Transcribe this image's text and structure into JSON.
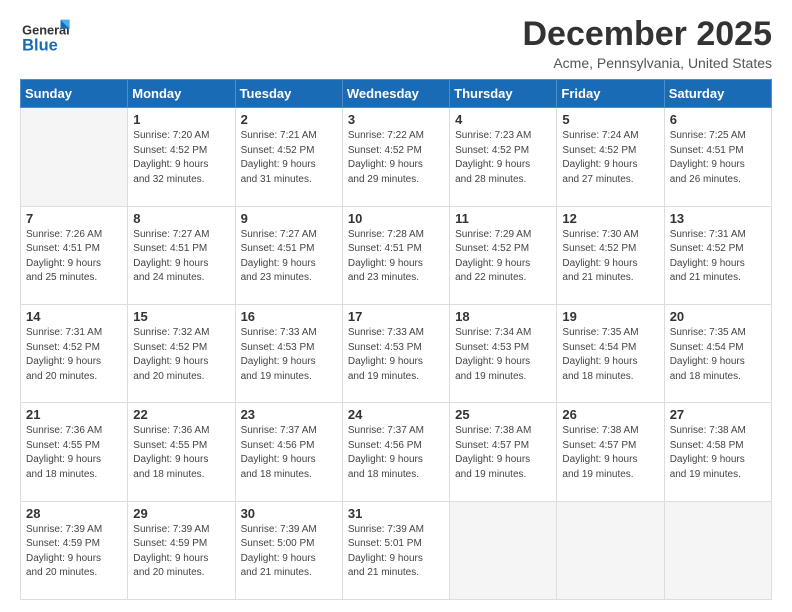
{
  "header": {
    "logo": {
      "line1": "General",
      "line2": "Blue"
    },
    "title": "December 2025",
    "location": "Acme, Pennsylvania, United States"
  },
  "weekdays": [
    "Sunday",
    "Monday",
    "Tuesday",
    "Wednesday",
    "Thursday",
    "Friday",
    "Saturday"
  ],
  "weeks": [
    [
      {
        "day": "",
        "info": ""
      },
      {
        "day": "1",
        "info": "Sunrise: 7:20 AM\nSunset: 4:52 PM\nDaylight: 9 hours\nand 32 minutes."
      },
      {
        "day": "2",
        "info": "Sunrise: 7:21 AM\nSunset: 4:52 PM\nDaylight: 9 hours\nand 31 minutes."
      },
      {
        "day": "3",
        "info": "Sunrise: 7:22 AM\nSunset: 4:52 PM\nDaylight: 9 hours\nand 29 minutes."
      },
      {
        "day": "4",
        "info": "Sunrise: 7:23 AM\nSunset: 4:52 PM\nDaylight: 9 hours\nand 28 minutes."
      },
      {
        "day": "5",
        "info": "Sunrise: 7:24 AM\nSunset: 4:52 PM\nDaylight: 9 hours\nand 27 minutes."
      },
      {
        "day": "6",
        "info": "Sunrise: 7:25 AM\nSunset: 4:51 PM\nDaylight: 9 hours\nand 26 minutes."
      }
    ],
    [
      {
        "day": "7",
        "info": "Sunrise: 7:26 AM\nSunset: 4:51 PM\nDaylight: 9 hours\nand 25 minutes."
      },
      {
        "day": "8",
        "info": "Sunrise: 7:27 AM\nSunset: 4:51 PM\nDaylight: 9 hours\nand 24 minutes."
      },
      {
        "day": "9",
        "info": "Sunrise: 7:27 AM\nSunset: 4:51 PM\nDaylight: 9 hours\nand 23 minutes."
      },
      {
        "day": "10",
        "info": "Sunrise: 7:28 AM\nSunset: 4:51 PM\nDaylight: 9 hours\nand 23 minutes."
      },
      {
        "day": "11",
        "info": "Sunrise: 7:29 AM\nSunset: 4:52 PM\nDaylight: 9 hours\nand 22 minutes."
      },
      {
        "day": "12",
        "info": "Sunrise: 7:30 AM\nSunset: 4:52 PM\nDaylight: 9 hours\nand 21 minutes."
      },
      {
        "day": "13",
        "info": "Sunrise: 7:31 AM\nSunset: 4:52 PM\nDaylight: 9 hours\nand 21 minutes."
      }
    ],
    [
      {
        "day": "14",
        "info": "Sunrise: 7:31 AM\nSunset: 4:52 PM\nDaylight: 9 hours\nand 20 minutes."
      },
      {
        "day": "15",
        "info": "Sunrise: 7:32 AM\nSunset: 4:52 PM\nDaylight: 9 hours\nand 20 minutes."
      },
      {
        "day": "16",
        "info": "Sunrise: 7:33 AM\nSunset: 4:53 PM\nDaylight: 9 hours\nand 19 minutes."
      },
      {
        "day": "17",
        "info": "Sunrise: 7:33 AM\nSunset: 4:53 PM\nDaylight: 9 hours\nand 19 minutes."
      },
      {
        "day": "18",
        "info": "Sunrise: 7:34 AM\nSunset: 4:53 PM\nDaylight: 9 hours\nand 19 minutes."
      },
      {
        "day": "19",
        "info": "Sunrise: 7:35 AM\nSunset: 4:54 PM\nDaylight: 9 hours\nand 18 minutes."
      },
      {
        "day": "20",
        "info": "Sunrise: 7:35 AM\nSunset: 4:54 PM\nDaylight: 9 hours\nand 18 minutes."
      }
    ],
    [
      {
        "day": "21",
        "info": "Sunrise: 7:36 AM\nSunset: 4:55 PM\nDaylight: 9 hours\nand 18 minutes."
      },
      {
        "day": "22",
        "info": "Sunrise: 7:36 AM\nSunset: 4:55 PM\nDaylight: 9 hours\nand 18 minutes."
      },
      {
        "day": "23",
        "info": "Sunrise: 7:37 AM\nSunset: 4:56 PM\nDaylight: 9 hours\nand 18 minutes."
      },
      {
        "day": "24",
        "info": "Sunrise: 7:37 AM\nSunset: 4:56 PM\nDaylight: 9 hours\nand 18 minutes."
      },
      {
        "day": "25",
        "info": "Sunrise: 7:38 AM\nSunset: 4:57 PM\nDaylight: 9 hours\nand 19 minutes."
      },
      {
        "day": "26",
        "info": "Sunrise: 7:38 AM\nSunset: 4:57 PM\nDaylight: 9 hours\nand 19 minutes."
      },
      {
        "day": "27",
        "info": "Sunrise: 7:38 AM\nSunset: 4:58 PM\nDaylight: 9 hours\nand 19 minutes."
      }
    ],
    [
      {
        "day": "28",
        "info": "Sunrise: 7:39 AM\nSunset: 4:59 PM\nDaylight: 9 hours\nand 20 minutes."
      },
      {
        "day": "29",
        "info": "Sunrise: 7:39 AM\nSunset: 4:59 PM\nDaylight: 9 hours\nand 20 minutes."
      },
      {
        "day": "30",
        "info": "Sunrise: 7:39 AM\nSunset: 5:00 PM\nDaylight: 9 hours\nand 21 minutes."
      },
      {
        "day": "31",
        "info": "Sunrise: 7:39 AM\nSunset: 5:01 PM\nDaylight: 9 hours\nand 21 minutes."
      },
      {
        "day": "",
        "info": ""
      },
      {
        "day": "",
        "info": ""
      },
      {
        "day": "",
        "info": ""
      }
    ]
  ]
}
